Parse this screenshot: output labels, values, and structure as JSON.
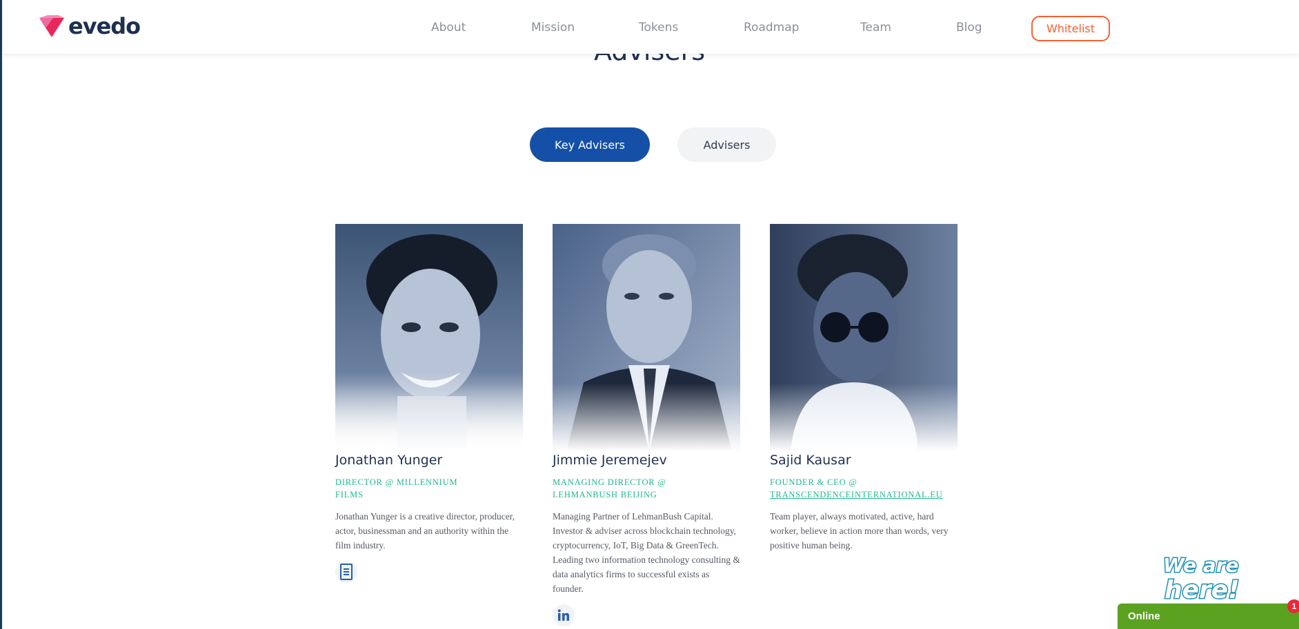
{
  "header": {
    "logo_text": "evedo",
    "nav": [
      {
        "label": "About"
      },
      {
        "label": "Mission"
      },
      {
        "label": "Tokens"
      },
      {
        "label": "Roadmap"
      },
      {
        "label": "Team"
      },
      {
        "label": "Blog"
      }
    ],
    "cta_label": "Whitelist"
  },
  "section": {
    "title": "Advisers",
    "tabs": [
      {
        "label": "Key Advisers",
        "active": true
      },
      {
        "label": "Advisers",
        "active": false
      }
    ]
  },
  "advisers": [
    {
      "name": "Jonathan Yunger",
      "role_line1": "DIRECTOR @ MILLENNIUM",
      "role_line2": "FILMS",
      "description": "Jonathan Yunger is a creative director, producer, actor, businessman and an authority within the film industry.",
      "social_icon": "document-icon"
    },
    {
      "name": "Jimmie Jeremejev",
      "role_line1": "MANAGING DIRECTOR @",
      "role_line2": "LEHMANBUSH BEIJING",
      "description": "Managing Partner of LehmanBush Capital. Investor & adviser across blockchain technology, cryptocurrency, IoT, Big Data & GreenTech. Leading two information technology consulting & data analytics firms to successful exists as founder.",
      "social_icon": "linkedin-icon"
    },
    {
      "name": "Sajid Kausar",
      "role_line1": "FOUNDER & CEO @",
      "role_line2": "TRANSCENDENCEINTERNATIONAL.EU",
      "description": "Team player, always motivated, active, hard worker, believe in action more than words, very positive human being.",
      "social_icon": ""
    }
  ],
  "chat": {
    "bubble_text": "We are here!",
    "status": "Online",
    "badge_count": "1"
  },
  "colors": {
    "brand_dark": "#1e3050",
    "accent_orange": "#f3622e",
    "tab_active": "#1550a8",
    "role_green": "#1fb88e",
    "chat_green": "#5aa21f"
  }
}
